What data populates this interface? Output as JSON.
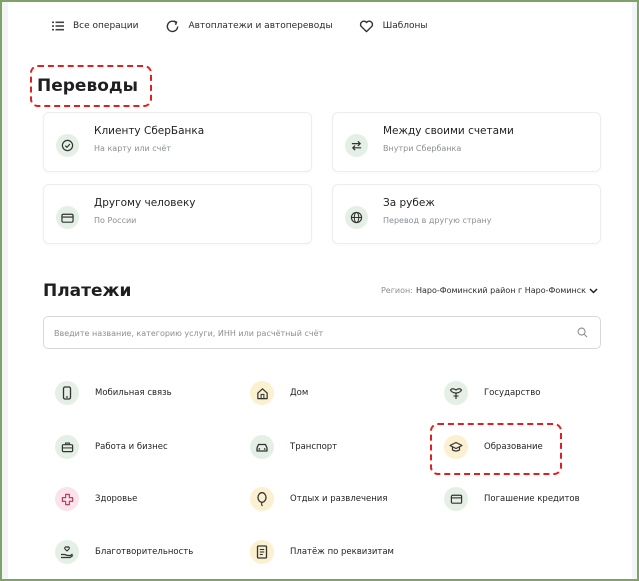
{
  "toolbar": {
    "all_operations": "Все операции",
    "autopayments": "Автоплатежи и автопереводы",
    "templates": "Шаблоны"
  },
  "transfers": {
    "title": "Переводы",
    "cards": [
      {
        "title": "Клиенту СберБанка",
        "subtitle": "На карту или счёт",
        "icon": "check-circle-icon"
      },
      {
        "title": "Между своими счетами",
        "subtitle": "Внутри Сбербанка",
        "icon": "swap-arrows-icon"
      },
      {
        "title": "Другому человеку",
        "subtitle": "По России",
        "icon": "card-icon"
      },
      {
        "title": "За рубеж",
        "subtitle": "Перевод в другую страну",
        "icon": "globe-icon"
      }
    ]
  },
  "payments": {
    "title": "Платежи",
    "region_label": "Регион:",
    "region_value": "Наро-Фоминский район г Наро-Фоминск",
    "search_placeholder": "Введите название, категорию услуги, ИНН или расчётный счёт",
    "categories": [
      {
        "label": "Мобильная связь",
        "icon": "phone-icon"
      },
      {
        "label": "Дом",
        "icon": "home-icon"
      },
      {
        "label": "Государство",
        "icon": "emblem-icon"
      },
      {
        "label": "Работа и бизнес",
        "icon": "briefcase-icon"
      },
      {
        "label": "Транспорт",
        "icon": "car-icon"
      },
      {
        "label": "Образование",
        "icon": "graduation-cap-icon"
      },
      {
        "label": "Здоровье",
        "icon": "medical-cross-icon"
      },
      {
        "label": "Отдых и развлечения",
        "icon": "balloon-icon"
      },
      {
        "label": "Погашение кредитов",
        "icon": "wallet-icon"
      },
      {
        "label": "Благотворительность",
        "icon": "charity-hand-icon"
      },
      {
        "label": "Платёж по реквизитам",
        "icon": "document-icon"
      }
    ]
  },
  "colors": {
    "accent_green": "#21a038",
    "highlight_red": "#e41e1e",
    "frame_border": "#7fa268"
  }
}
